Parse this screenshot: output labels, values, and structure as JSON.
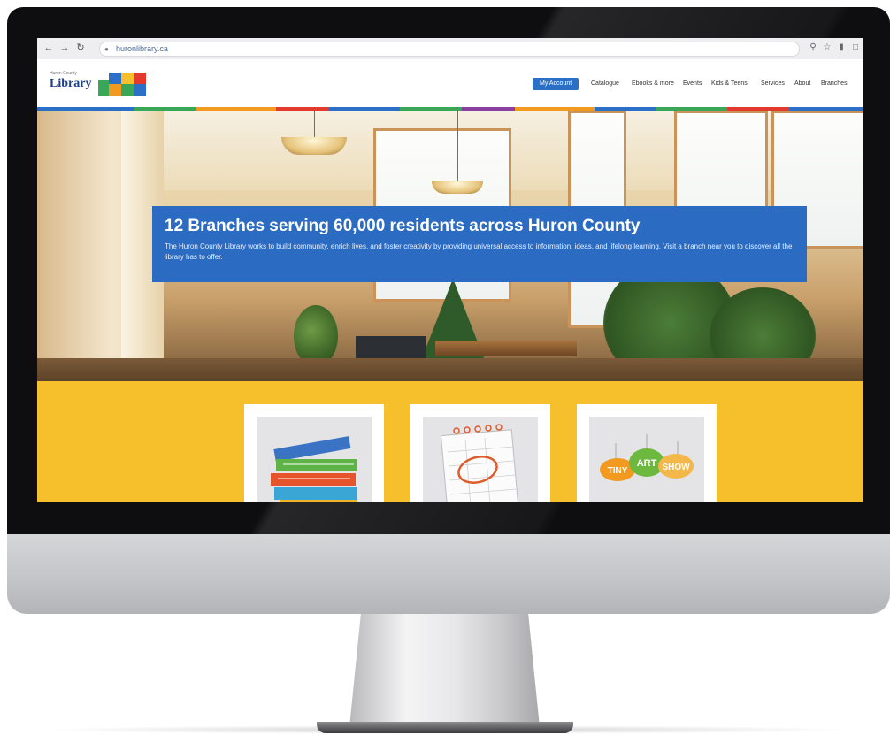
{
  "browser": {
    "url": "huronlibrary.ca",
    "back_icon": "arrow-left-icon",
    "forward_icon": "arrow-right-icon",
    "reload_icon": "reload-icon"
  },
  "site": {
    "logo_small": "Huron County",
    "logo_word": "Library",
    "nav_cta": "My Account",
    "nav_links": [
      "Catalogue",
      "Ebooks & more",
      "Events",
      "Kids & Teens",
      "Services",
      "About",
      "Branches"
    ]
  },
  "hero": {
    "title": "12 Branches serving 60,000 residents across Huron County",
    "body": "The Huron County Library works to build community, enrich lives, and foster creativity by providing universal access to information, ideas, and lifelong learning. Visit a branch near you to discover all the library has to offer."
  },
  "cards": [
    {
      "name": "books-card",
      "icon": "books-stack-icon"
    },
    {
      "name": "calendar-card",
      "icon": "calendar-icon"
    },
    {
      "name": "tiny-art-show-card",
      "icon": "tiny-art-show-icon",
      "badge_words": [
        "TINY",
        "ART",
        "SHOW"
      ]
    }
  ],
  "colors": {
    "brand_blue": "#2c6bc2",
    "section_yellow": "#f6c02d",
    "stripe": [
      "#2b6fc6",
      "#3aa657",
      "#f29a1f",
      "#e23b2e",
      "#8b3fa0"
    ]
  }
}
